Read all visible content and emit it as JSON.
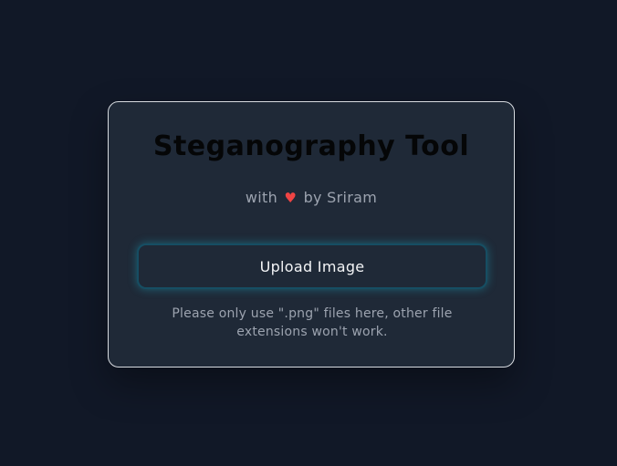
{
  "card": {
    "title": "Steganography Tool",
    "subtitle_prefix": "with",
    "subtitle_suffix": "by Sriram",
    "heart_icon": "♥",
    "upload_button_label": "Upload Image",
    "note_line1": "Please only use \".png\" files here, other file",
    "note_line2": "extensions won't work."
  },
  "colors": {
    "background": "#111827",
    "card": "#1f2937",
    "accent_glow": "#22d3ee",
    "heart": "#ef4444"
  }
}
